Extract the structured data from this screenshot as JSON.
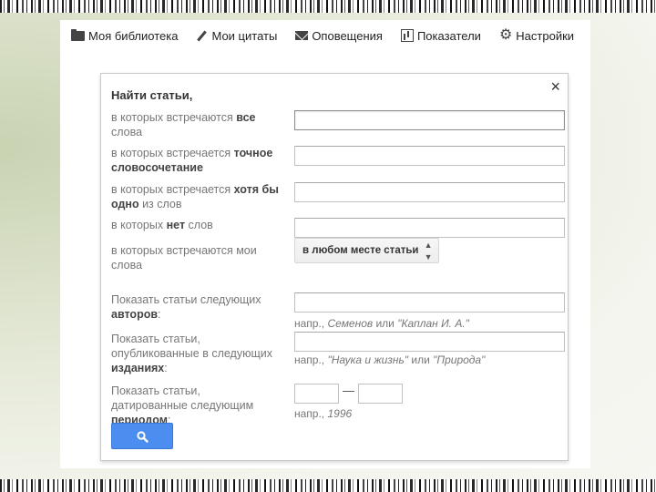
{
  "nav": {
    "items": [
      {
        "label": "Моя библиотека",
        "icon": "folder-icon"
      },
      {
        "label": "Мои цитаты",
        "icon": "pencil-icon"
      },
      {
        "label": "Оповещения",
        "icon": "mail-icon"
      },
      {
        "label": "Показатели",
        "icon": "chart-icon"
      },
      {
        "label": "Настройки",
        "icon": "gear-icon"
      }
    ]
  },
  "dialog": {
    "title": "Найти статьи,",
    "close": "×",
    "all_words": {
      "pre": "в которых встречаются ",
      "bold": "все",
      "post": " слова"
    },
    "exact_phrase": {
      "pre": "в которых встречается ",
      "bold": "точное словосочетание",
      "post": ""
    },
    "any_words": {
      "pre": "в которых встречается ",
      "bold": "хотя бы одно",
      "post": " из слов"
    },
    "without_words": {
      "pre": "в которых ",
      "bold": "нет",
      "post": " слов"
    },
    "where_words": {
      "pre": "в которых встречаются мои слова",
      "select_value": "в любом месте статьи"
    },
    "authors": {
      "pre": "Показать статьи следующих ",
      "bold": "авторов",
      "post": ":",
      "hint_prefix": "напр., ",
      "hint_italic1": "Семенов",
      "hint_mid": " или ",
      "hint_italic2": "\"Каплан И. А.\""
    },
    "publication": {
      "pre": "Показать статьи, опубликованные в следующих ",
      "bold": "изданиях",
      "post": ":",
      "hint_prefix": "напр., ",
      "hint_italic1": "\"Наука и жизнь\"",
      "hint_mid": " или ",
      "hint_italic2": "\"Природа\""
    },
    "period": {
      "pre": "Показать статьи, датированные следующим ",
      "bold": "периодом",
      "post": ":",
      "dash": "—",
      "hint_prefix": "напр., ",
      "hint_italic": "1996"
    }
  },
  "colors": {
    "search_button": "#4c8df0"
  }
}
